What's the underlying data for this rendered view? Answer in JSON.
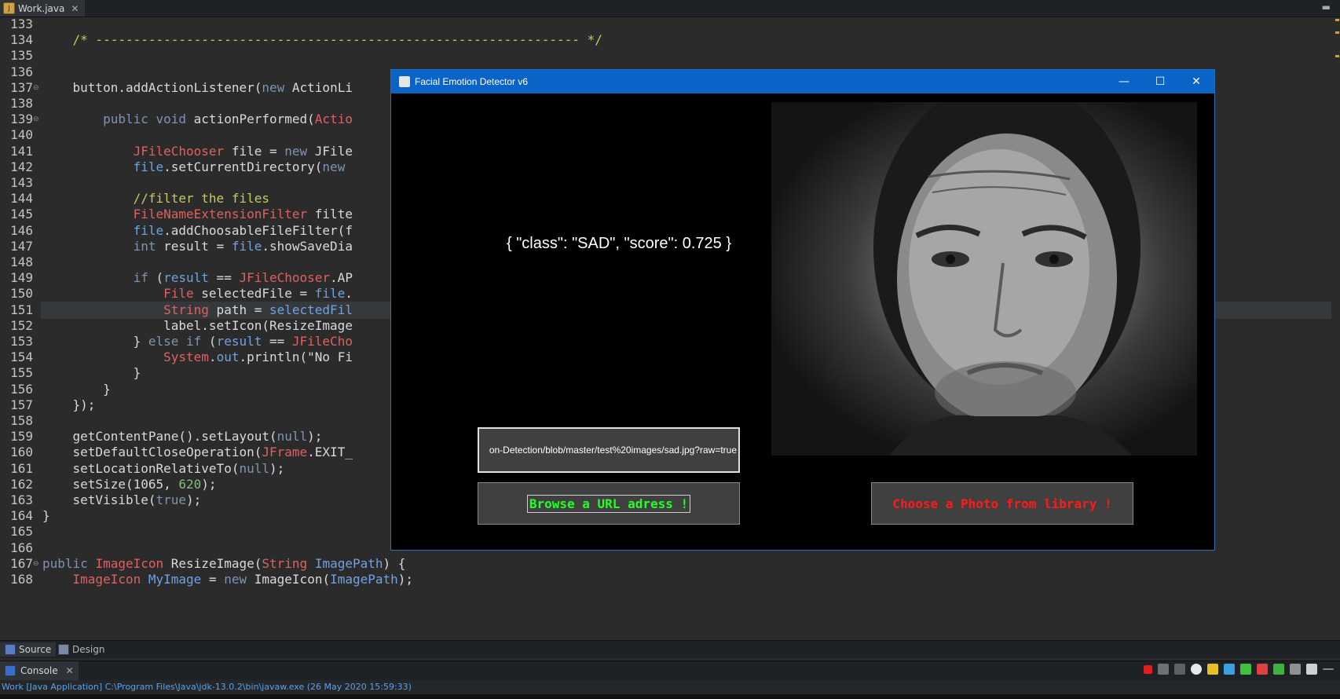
{
  "ide": {
    "tab_title": "Work.java",
    "lines": [
      {
        "n": "133",
        "html": ""
      },
      {
        "n": "134",
        "html": "<span class='cm'>    /* ---------------------------------------------------------------- */</span>"
      },
      {
        "n": "135",
        "html": ""
      },
      {
        "n": "136",
        "html": ""
      },
      {
        "n": "137",
        "html": "    button.addActionListener(<span class='kw'>new</span> ActionLi"
      },
      {
        "n": "138",
        "html": ""
      },
      {
        "n": "139",
        "html": "        <span class='kw'>public void</span> actionPerformed(<span class='ty'>Actio</span>"
      },
      {
        "n": "140",
        "html": ""
      },
      {
        "n": "141",
        "html": "            <span class='ty'>JFileChooser</span> file = <span class='kw'>new</span> JFile"
      },
      {
        "n": "142",
        "html": "            <span class='fld'>file</span>.setCurrentDirectory(<span class='kw'>new</span>"
      },
      {
        "n": "143",
        "html": ""
      },
      {
        "n": "144",
        "html": "            <span class='cm'>//filter the files</span>"
      },
      {
        "n": "145",
        "html": "            <span class='ty'>FileNameExtensionFilter</span> filte"
      },
      {
        "n": "146",
        "html": "            <span class='fld'>file</span>.addChoosableFileFilter(f"
      },
      {
        "n": "147",
        "html": "            <span class='kw'>int</span> result = <span class='fld'>file</span>.showSaveDia"
      },
      {
        "n": "148",
        "html": ""
      },
      {
        "n": "149",
        "html": "            <span class='kw'>if</span> (<span class='fld'>result</span> == <span class='ty'>JFileChooser</span>.AP"
      },
      {
        "n": "150",
        "html": "                <span class='ty'>File</span> selectedFile = <span class='fld'>file</span>."
      },
      {
        "n": "151",
        "html": "                <span class='ty'>String</span> path = <span class='fld'>selectedFil</span>"
      },
      {
        "n": "152",
        "html": "                label.setIcon(ResizeImage"
      },
      {
        "n": "153",
        "html": "            } <span class='kw'>else if</span> (<span class='fld'>result</span> == <span class='ty'>JFileCho</span>"
      },
      {
        "n": "154",
        "html": "                <span class='ty'>System</span>.<span class='fld'>out</span>.println(\"No Fi"
      },
      {
        "n": "155",
        "html": "            }"
      },
      {
        "n": "156",
        "html": "        }"
      },
      {
        "n": "157",
        "html": "    });"
      },
      {
        "n": "158",
        "html": ""
      },
      {
        "n": "159",
        "html": "    getContentPane().setLayout(<span class='kw'>null</span>);"
      },
      {
        "n": "160",
        "html": "    setDefaultCloseOperation(<span class='ty'>JFrame</span>.EXIT_"
      },
      {
        "n": "161",
        "html": "    setLocationRelativeTo(<span class='kw'>null</span>);"
      },
      {
        "n": "162",
        "html": "    setSize(1065, <span class='num'>620</span>);"
      },
      {
        "n": "163",
        "html": "    setVisible(<span class='kw'>true</span>);"
      },
      {
        "n": "164",
        "html": "}"
      },
      {
        "n": "165",
        "html": ""
      },
      {
        "n": "166",
        "html": ""
      },
      {
        "n": "167",
        "html": "<span class='kw'>public</span> <span class='ty'>ImageIcon</span> ResizeImage(<span class='ty'>String</span> <span class='fld'>ImagePath</span>) {"
      },
      {
        "n": "168",
        "html": "    <span class='ty'>ImageIcon</span> <span class='fld'>MyImage</span> = <span class='kw'>new</span> ImageIcon(<span class='fld'>ImagePath</span>);"
      }
    ],
    "source_tab": "Source",
    "design_tab": "Design",
    "console_tab": "Console",
    "status_text": "Work [Java Application] C:\\Program Files\\Java\\jdk-13.0.2\\bin\\javaw.exe (26 May 2020 15:59:33)"
  },
  "app": {
    "title": "Facial Emotion Detector v6",
    "result_text": "{ \"class\": \"SAD\", \"score\": 0.725 }",
    "url_value": "on-Detection/blob/master/test%20images/sad.jpg?raw=true",
    "browse_label": "Browse a URL adress !",
    "choose_label": "Choose a Photo from library !",
    "photo_alt": "portrait-photo"
  }
}
